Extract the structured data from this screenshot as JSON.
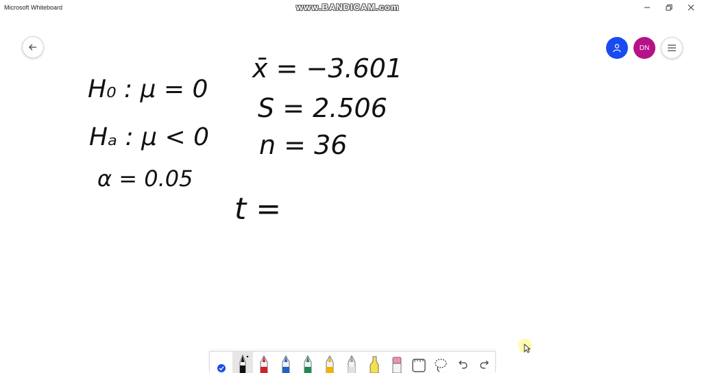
{
  "window": {
    "title": "Microsoft Whiteboard",
    "controls": {
      "minimize": "—",
      "restore": "❐",
      "close": "✕"
    }
  },
  "watermark": "www.BANDICAM.com",
  "header": {
    "back_icon": "arrow-left-icon",
    "user_icon": "person-icon",
    "user_color": "#1a4bf0",
    "avatar_initials": "DN",
    "avatar_color": "#b5128a",
    "menu_icon": "hamburger-icon"
  },
  "canvas": {
    "hypotheses": {
      "null": "H₀ : μ = 0",
      "alternative": "Hₐ : μ < 0",
      "alpha": "α = 0.05"
    },
    "stats": {
      "mean": "x̄ = −3.601",
      "sd": "S = 2.506",
      "n": "n = 36"
    },
    "test_stat": "t ="
  },
  "toolbar": {
    "tools": [
      "select-check-icon",
      "pen-black-icon",
      "pen-red-icon",
      "pen-blue-icon",
      "pen-green-icon",
      "pen-yellow-icon",
      "pen-gray-icon",
      "highlighter-yellow-icon",
      "eraser-pink-icon",
      "ruler-icon",
      "lasso-icon",
      "undo-icon",
      "redo-icon"
    ],
    "active_tool": "pen-black-icon",
    "colors": {
      "black": "#111111",
      "red": "#d1212c",
      "blue": "#1f63c9",
      "green": "#1e8a5a",
      "yellow": "#f0b400",
      "gray": "#9aa0a6",
      "highlighter": "#f4e04d",
      "eraser": "#f08fb4",
      "select": "#1a4bf0"
    }
  }
}
